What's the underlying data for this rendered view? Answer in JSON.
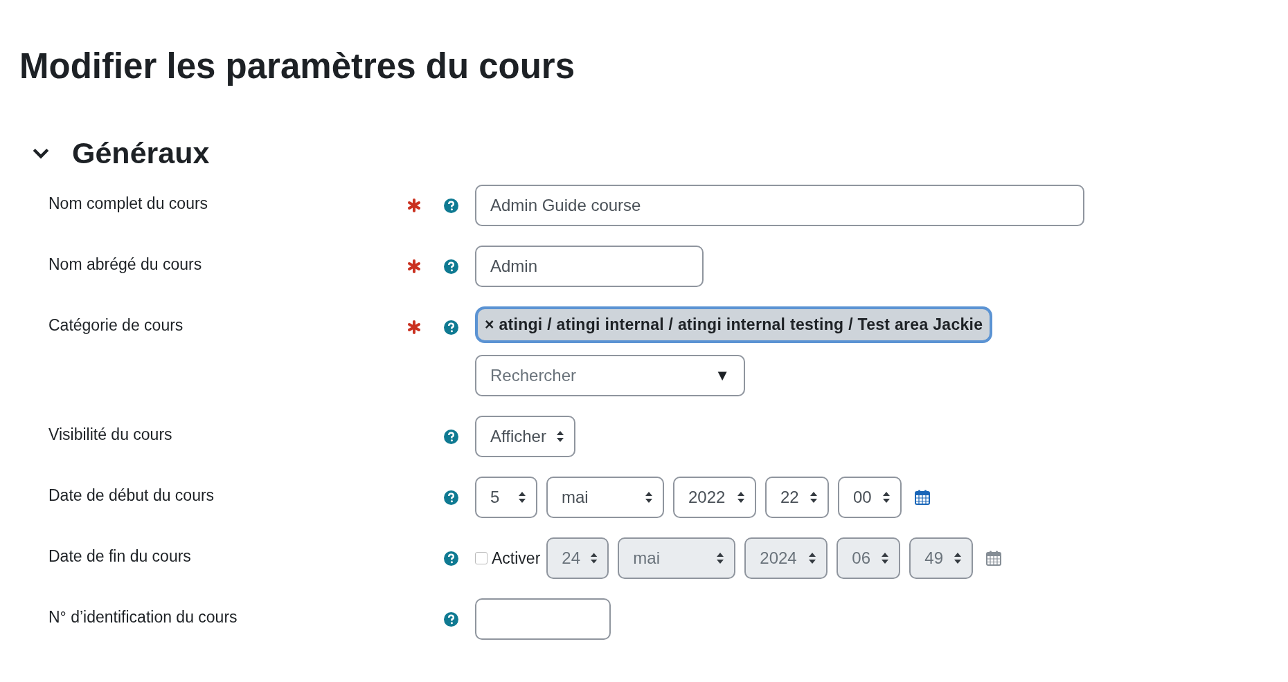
{
  "page_title": "Modifier les paramètres du cours",
  "section": {
    "title": "Généraux",
    "expanded": true
  },
  "rows": [
    {
      "kind": "text",
      "label": "Nom complet du cours",
      "required": true,
      "help": true,
      "value": "Admin Guide course"
    },
    {
      "kind": "text",
      "label": "Nom abrégé du cours",
      "required": true,
      "help": true,
      "value": "Admin"
    },
    {
      "kind": "autocomplete",
      "label": "Catégorie de cours",
      "required": true,
      "help": true,
      "tag": {
        "remove": "×",
        "text": "atingi / atingi internal / atingi internal testing / Test area Jackie"
      },
      "placeholder": "Rechercher",
      "caret": "▼"
    },
    {
      "kind": "select",
      "label": "Visibilité du cours",
      "required": false,
      "help": true,
      "value": "Afficher"
    },
    {
      "kind": "date",
      "label": "Date de début du cours",
      "required": false,
      "help": true,
      "disabled": false,
      "parts": [
        "5",
        "mai",
        "2022",
        "22",
        "00"
      ]
    },
    {
      "kind": "date",
      "label": "Date de fin du cours",
      "required": false,
      "help": true,
      "disabled": true,
      "enable": {
        "label": "Activer",
        "checked": false
      },
      "parts": [
        "24",
        "mai",
        "2024",
        "06",
        "49"
      ]
    },
    {
      "kind": "text",
      "label": "N° d’identification du cours",
      "required": false,
      "help": true
    }
  ]
}
